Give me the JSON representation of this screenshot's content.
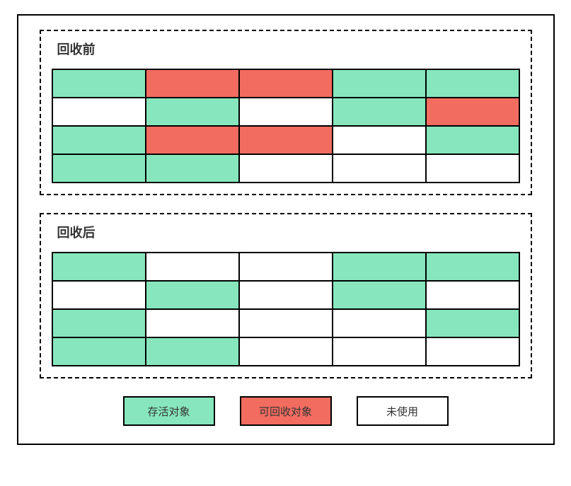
{
  "colors": {
    "alive": "#87e6bd",
    "recyclable": "#f36c60",
    "unused": "#ffffff"
  },
  "phases": {
    "before": {
      "title": "回收前",
      "grid": [
        [
          "alive",
          "recyclable",
          "recyclable",
          "alive",
          "alive"
        ],
        [
          "unused",
          "alive",
          "unused",
          "alive",
          "recyclable"
        ],
        [
          "alive",
          "recyclable",
          "recyclable",
          "unused",
          "alive"
        ],
        [
          "alive",
          "alive",
          "unused",
          "unused",
          "unused"
        ]
      ]
    },
    "after": {
      "title": "回收后",
      "grid": [
        [
          "alive",
          "unused",
          "unused",
          "alive",
          "alive"
        ],
        [
          "unused",
          "alive",
          "unused",
          "alive",
          "unused"
        ],
        [
          "alive",
          "unused",
          "unused",
          "unused",
          "alive"
        ],
        [
          "alive",
          "alive",
          "unused",
          "unused",
          "unused"
        ]
      ]
    }
  },
  "legend": {
    "alive": "存活对象",
    "recyclable": "可回收对象",
    "unused": "未使用"
  }
}
